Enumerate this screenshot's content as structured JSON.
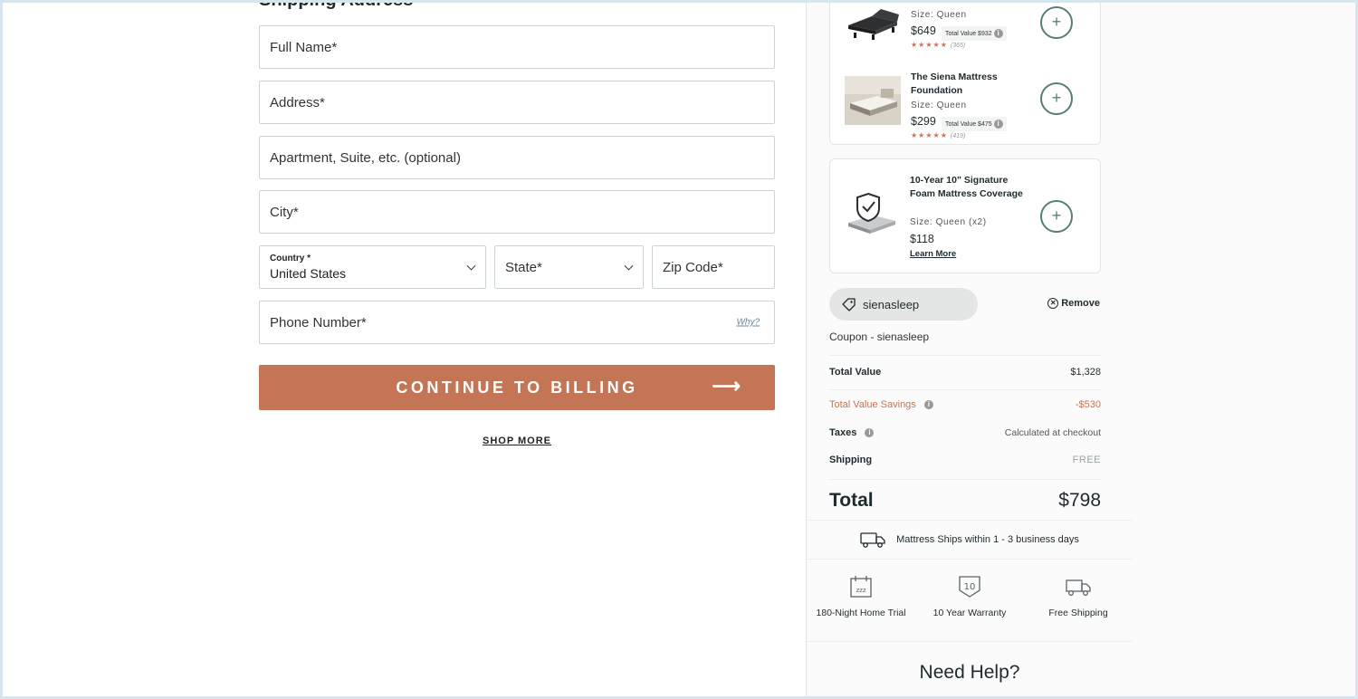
{
  "shipping_form": {
    "section_title": "Shipping Address",
    "full_name_placeholder": "Full Name*",
    "address_placeholder": "Address*",
    "apartment_placeholder": "Apartment, Suite, etc. (optional)",
    "city_placeholder": "City*",
    "country_label": "Country *",
    "country_value": "United States",
    "state_placeholder": "State*",
    "zip_placeholder": "Zip Code*",
    "phone_placeholder": "Phone Number*",
    "phone_help_link": "Why?",
    "continue_label": "CONTINUE TO BILLING",
    "continue_arrow": "⟶",
    "shop_more_label": "SHOP MORE"
  },
  "cart": {
    "items": [
      {
        "name": "",
        "size": "Size: Queen",
        "price": "$649",
        "total_value": "Total Value $932",
        "stars": "★★★★★",
        "reviews": "(365)",
        "add_symbol": "+"
      },
      {
        "name": "The Siena Mattress Foundation",
        "size": "Size: Queen",
        "price": "$299",
        "total_value": "Total Value $475",
        "stars": "★★★★★",
        "reviews": "(419)",
        "add_symbol": "+"
      }
    ],
    "coverage": {
      "name": "10-Year 10\" Signature Foam Mattress Coverage",
      "size": "Size: Queen (x2)",
      "price": "$118",
      "learn_more": "Learn More",
      "add_symbol": "+"
    }
  },
  "coupon": {
    "code": "sienasleep",
    "remove_label": "Remove",
    "coupon_line": "Coupon - sienasleep"
  },
  "totals": {
    "total_value_label": "Total Value",
    "total_value": "$1,328",
    "savings_label": "Total Value Savings",
    "savings_value": "-$530",
    "taxes_label": "Taxes",
    "taxes_value": "Calculated at checkout",
    "shipping_label": "Shipping",
    "shipping_value": "FREE",
    "total_label": "Total",
    "total_value_final": "$798"
  },
  "shipping_note": "Mattress Ships within 1 - 3 business days",
  "badges": [
    {
      "label": "180-Night Home Trial",
      "icon": "calendar-zzz-icon"
    },
    {
      "label": "10 Year Warranty",
      "icon": "warranty-shield-icon"
    },
    {
      "label": "Free Shipping",
      "icon": "truck-icon"
    }
  ],
  "help_title": "Need Help?",
  "colors": {
    "accent": "#c47555",
    "teal": "#5b7d7a",
    "text": "#1f2a2e",
    "background": "#d7e6ec"
  }
}
